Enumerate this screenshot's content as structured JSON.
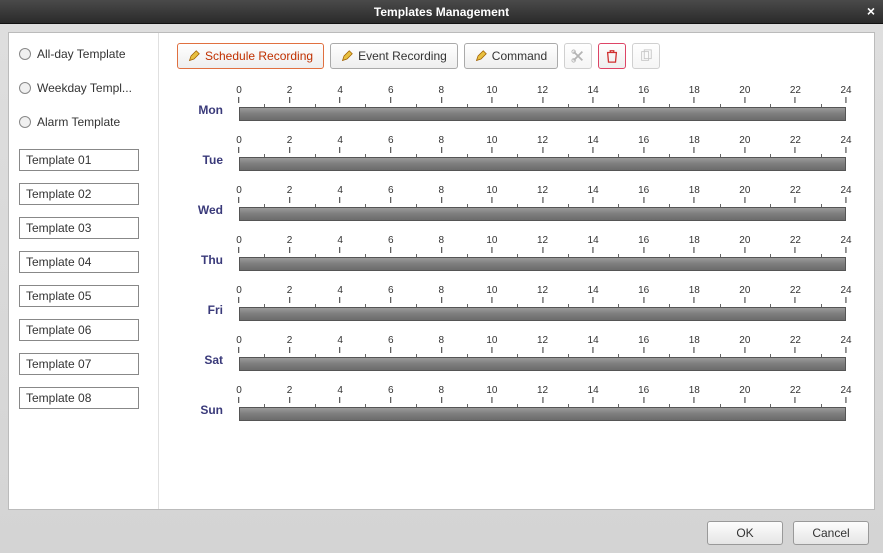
{
  "window": {
    "title": "Templates Management"
  },
  "sidebar": {
    "radios": [
      {
        "label": "All-day Template"
      },
      {
        "label": "Weekday Templ..."
      },
      {
        "label": "Alarm Template"
      }
    ],
    "templates": [
      {
        "value": "Template 01"
      },
      {
        "value": "Template 02"
      },
      {
        "value": "Template 03"
      },
      {
        "value": "Template 04"
      },
      {
        "value": "Template 05"
      },
      {
        "value": "Template 06"
      },
      {
        "value": "Template 07"
      },
      {
        "value": "Template 08"
      }
    ]
  },
  "toolbar": {
    "schedule_recording": "Schedule Recording",
    "event_recording": "Event Recording",
    "command": "Command"
  },
  "schedule": {
    "hours": [
      0,
      2,
      4,
      6,
      8,
      10,
      12,
      14,
      16,
      18,
      20,
      22,
      24
    ],
    "days": [
      {
        "label": "Mon"
      },
      {
        "label": "Tue"
      },
      {
        "label": "Wed"
      },
      {
        "label": "Thu"
      },
      {
        "label": "Fri"
      },
      {
        "label": "Sat"
      },
      {
        "label": "Sun"
      }
    ]
  },
  "footer": {
    "ok": "OK",
    "cancel": "Cancel"
  }
}
